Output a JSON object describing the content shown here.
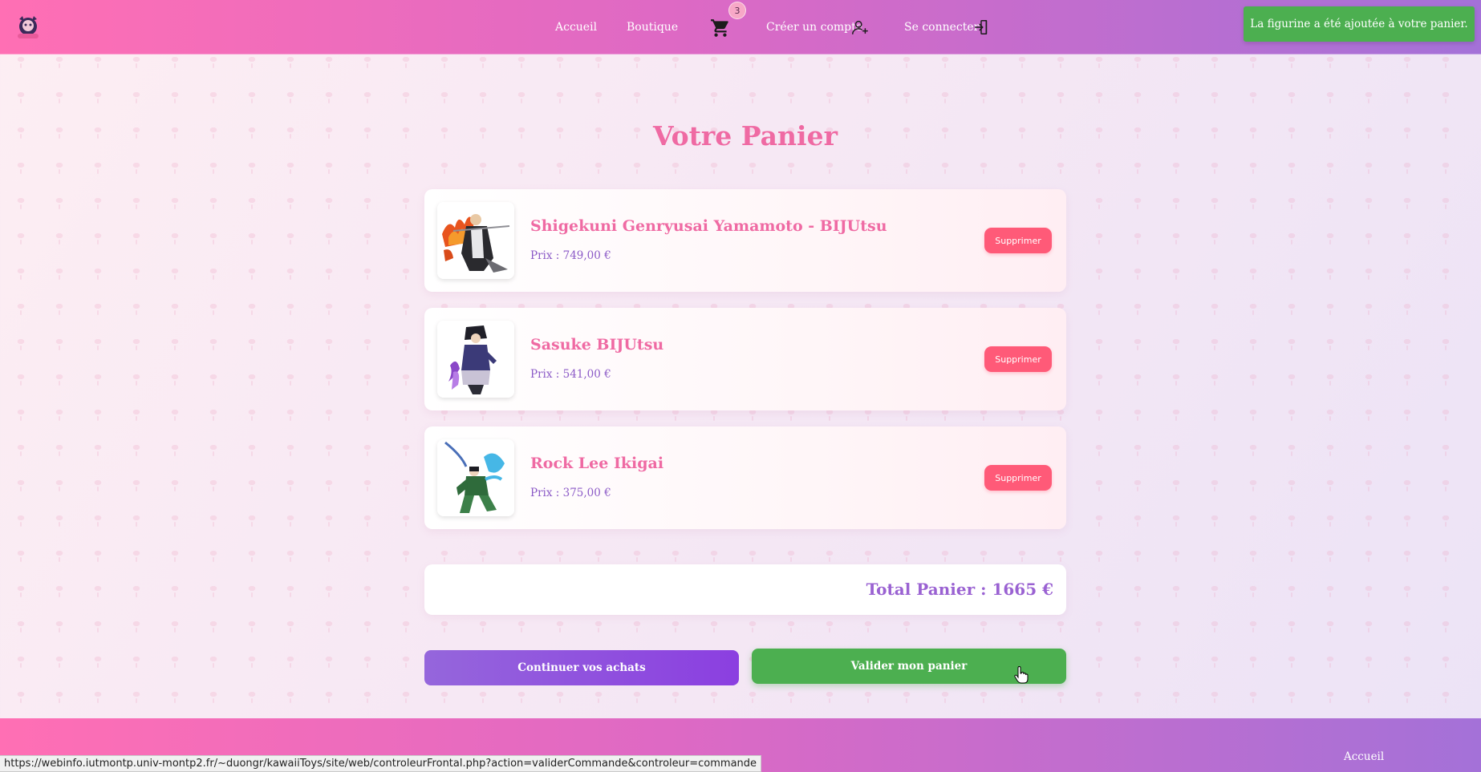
{
  "header": {
    "nav": {
      "home": "Accueil",
      "shop": "Boutique",
      "cart_count": "3",
      "signup": "Créer un compte",
      "login": "Se connecter"
    },
    "toast": "La figurine a été ajoutée à votre panier."
  },
  "main": {
    "title": "Votre Panier",
    "items": [
      {
        "name": "Shigekuni Genryusai Yamamoto - BIJUtsu",
        "price": "Prix : 749,00 €",
        "delete_label": "Supprimer"
      },
      {
        "name": "Sasuke BIJUtsu",
        "price": "Prix : 541,00 €",
        "delete_label": "Supprimer"
      },
      {
        "name": "Rock Lee Ikigai",
        "price": "Prix : 375,00 €",
        "delete_label": "Supprimer"
      }
    ],
    "total": "Total Panier : 1665 €",
    "continue_label": "Continuer vos achats",
    "validate_label": "Valider mon panier"
  },
  "footer": {
    "home": "Accueil"
  },
  "status_bar": {
    "url": "https://webinfo.iutmontp.univ-montp2.fr/~duongr/kawaiiToys/site/web/controleurFrontal.php?action=validerCommande&controleur=commande"
  },
  "colors": {
    "brand_pink": "#ef6aa3",
    "accent_purple": "#9a62d2",
    "success_green": "#4caf50",
    "delete_red": "#ff5a78"
  }
}
